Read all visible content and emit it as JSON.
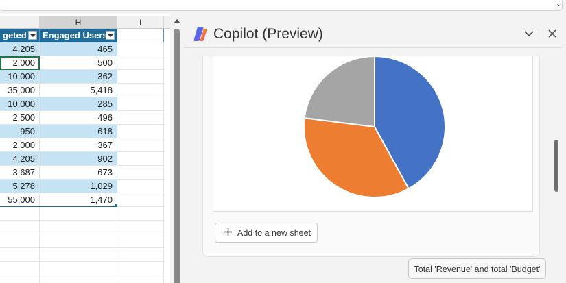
{
  "window": {
    "expand_icon": "chevron-down-icon"
  },
  "sheet": {
    "columns": [
      {
        "letter": "",
        "header": "geted",
        "selected": false
      },
      {
        "letter": "H",
        "header": "Engaged Users",
        "selected": true
      },
      {
        "letter": "I",
        "header": "",
        "selected": false
      }
    ],
    "rows": [
      [
        "4,205",
        "465"
      ],
      [
        "2,000",
        "500"
      ],
      [
        "10,000",
        "362"
      ],
      [
        "35,000",
        "5,418"
      ],
      [
        "10,000",
        "285"
      ],
      [
        "2,500",
        "496"
      ],
      [
        "950",
        "618"
      ],
      [
        "2,000",
        "367"
      ],
      [
        "4,205",
        "902"
      ],
      [
        "3,687",
        "673"
      ],
      [
        "5,278",
        "1,029"
      ],
      [
        "55,000",
        "1,470"
      ]
    ],
    "empty_rows": 6
  },
  "copilot": {
    "title": "Copilot (Preview)",
    "minimize_icon": "chevron-down-icon",
    "close_icon": "close-icon",
    "add_to_sheet_label": "Add to a new sheet",
    "suggestion": "Total 'Revenue' and total 'Budget'"
  },
  "colors": {
    "table_header": "#1f6a96",
    "band": "#c5e3f3",
    "active_cell": "#217346",
    "series": [
      "#4472c4",
      "#ed7d31",
      "#a5a5a5"
    ]
  },
  "chart_data": {
    "type": "pie",
    "values": [
      42,
      35,
      23
    ],
    "colors": [
      "#4472c4",
      "#ed7d31",
      "#a5a5a5"
    ],
    "start_angle_deg": 0,
    "direction": "clockwise",
    "legend": "none"
  }
}
